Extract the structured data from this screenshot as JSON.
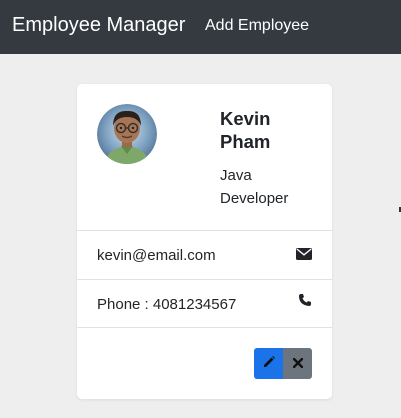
{
  "navbar": {
    "brand": "Employee Manager",
    "add_link": "Add Employee"
  },
  "employee": {
    "name": "Kevin Pham",
    "job_title": "Java Developer",
    "email": "kevin@email.com",
    "phone": "Phone : 4081234567"
  },
  "icons": {
    "email": "envelope-icon",
    "phone": "phone-icon",
    "edit": "pencil-icon",
    "delete": "close-icon"
  },
  "colors": {
    "navbar": "#343a40",
    "background": "#eeeeee",
    "edit_button": "#1a73e8",
    "delete_button": "#6c757d"
  }
}
